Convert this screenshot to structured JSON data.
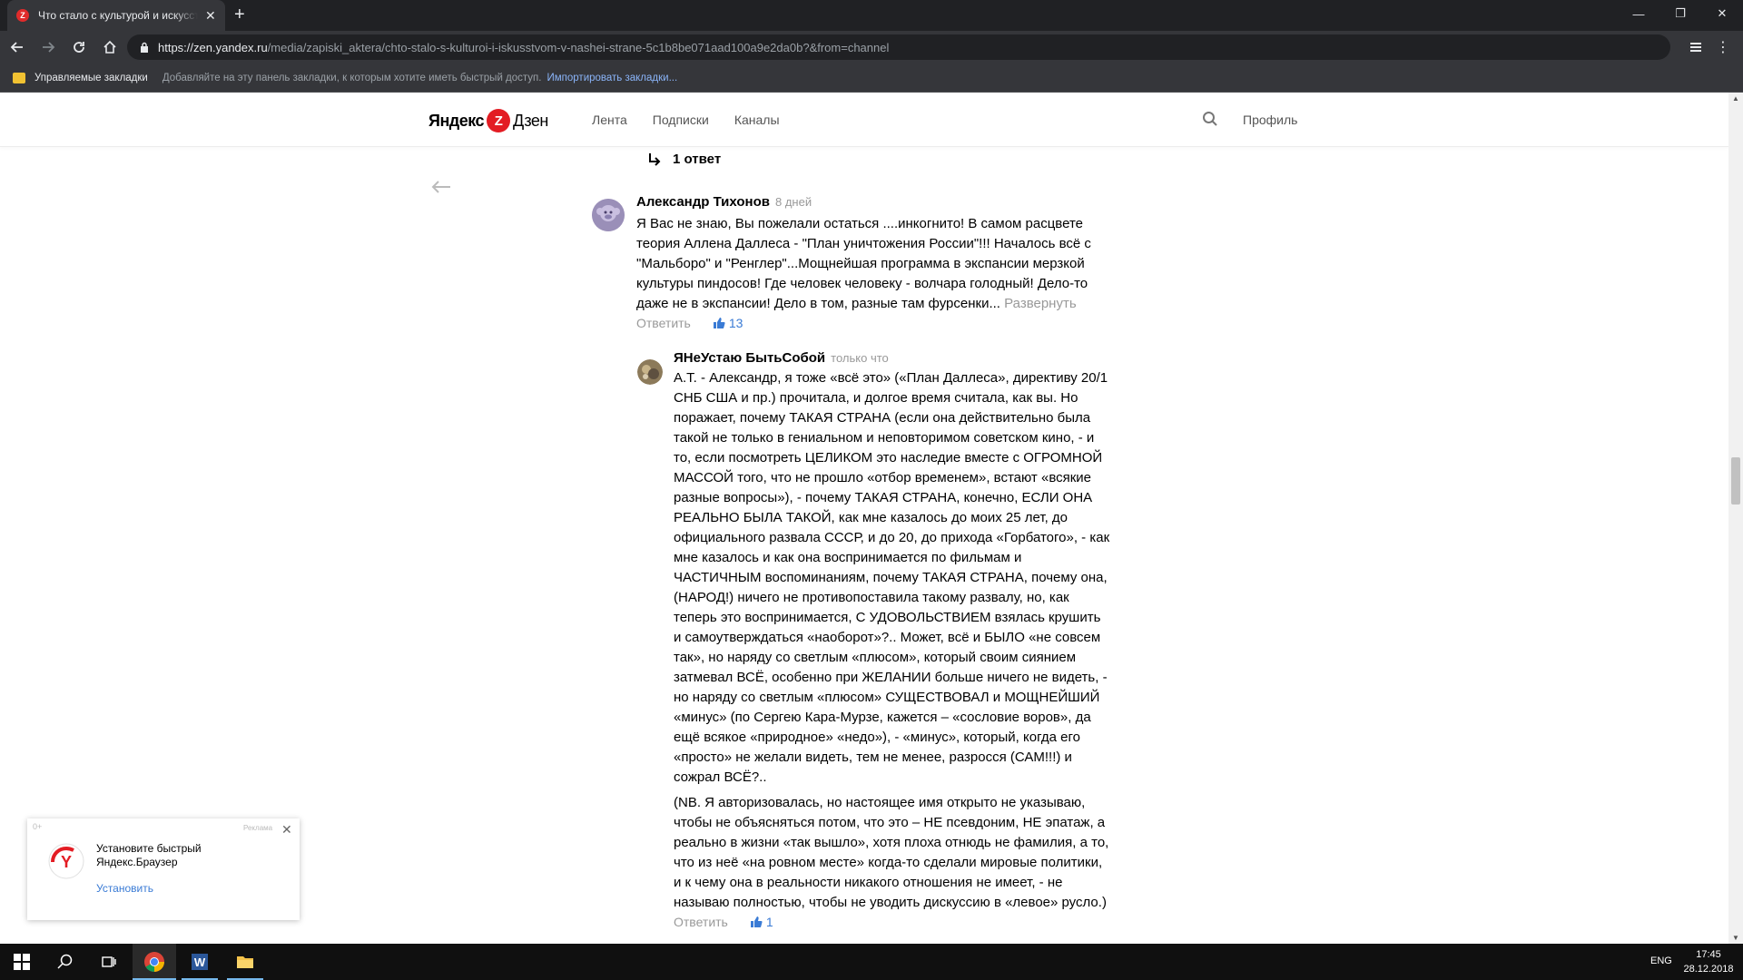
{
  "browser": {
    "tab_title": "Что стало с культурой и искусством в нашей стране",
    "tab_favicon_letter": "Z",
    "url_host": "https://zen.yandex.ru",
    "url_path": "/media/zapiski_aktera/chto-stalo-s-kulturoi-i-iskusstvom-v-nashei-strane-5c1b8be071aad100a9e2da0b?&from=channel",
    "bookmarks": {
      "managed": "Управляемые закладки",
      "hint": "Добавляйте на эту панель закладки, к которым хотите иметь быстрый доступ.",
      "import": "Импортировать закладки..."
    }
  },
  "zen": {
    "logo_ya": "Яндекс",
    "logo_z": "Z",
    "logo_dzen": "Дзен",
    "nav": [
      "Лента",
      "Подписки",
      "Каналы"
    ],
    "profile": "Профиль",
    "accent": "#e31c23"
  },
  "thread": {
    "replies_label": "1 ответ"
  },
  "comments": [
    {
      "author": "Александр Тихонов",
      "time": "8 дней",
      "lines": [
        "Я Вас не знаю, Вы пожелали остаться ....инкогнито! В самом расцвете",
        "теория Аллена Даллеса - \"План уничтожения России\"!!! Началось всё с",
        "\"Мальборо\" и \"Ренглер\"...Мощнейшая программа в экспансии мерзкой",
        "культуры пиндосов! Где человек человеку - волчара голодный! Дело-то",
        "даже не в экспансии! Дело в том, разные там фурсенки..."
      ],
      "expand": "Развернуть",
      "reply": "Ответить",
      "likes": "13"
    },
    {
      "author": "ЯНеУстаю БытьСобой",
      "time": "только что",
      "lines": [
        "А.Т. - Александр, я тоже «всё это» («План Даллеса», директиву 20/1",
        "СНБ США и пр.) прочитала, и долгое время считала, как вы. Но",
        "поражает, почему ТАКАЯ СТРАНА (если она действительно была",
        "такой не только в гениальном и неповторимом советском кино, - и",
        "то, если посмотреть ЦЕЛИКОМ это наследие вместе с ОГРОМНОЙ",
        "МАССОЙ того, что не прошло «отбор временем», встают «всякие",
        "разные вопросы»), - почему ТАКАЯ СТРАНА, конечно, ЕСЛИ ОНА",
        "РЕАЛЬНО БЫЛА ТАКОЙ, как мне казалось до моих 25 лет, до",
        "официального развала СССР, и до 20, до прихода «Горбатого», - как",
        "мне казалось и как она воспринимается по фильмам и",
        "ЧАСТИЧНЫМ воспоминаниям, почему ТАКАЯ СТРАНА, почему она,",
        "(НАРОД!) ничего не противопоставила такому развалу, но, как",
        "теперь это воспринимается, С УДОВОЛЬСТВИЕМ взялась крушить",
        "и самоутверждаться «наоборот»?.. Может, всё и БЫЛО «не совсем",
        "так», но наряду со светлым «плюсом», который своим сиянием",
        "затмевал ВСЁ, особенно при ЖЕЛАНИИ больше ничего не видеть, -",
        "но наряду со светлым «плюсом» СУЩЕСТВОВАЛ и МОЩНЕЙШИЙ",
        "«минус» (по Сергею Кара-Мурзе, кажется – «сословие воров», да",
        "ещё всякое «природное» «недо»), - «минус», который, когда его",
        "«просто» не желали видеть, тем не менее, разросся (САМ!!!) и",
        "сожрал ВСЁ?.."
      ],
      "lines2": [
        "(NB. Я авторизовалась, но настоящее имя открыто не указываю,",
        "чтобы не объясняться потом, что это – НЕ псевдоним, НЕ эпатаж, а",
        "реально в жизни «так вышло», хотя плоха отнюдь не фамилия, а то,",
        "что из неё «на ровном месте» когда-то сделали мировые политики,",
        "и к чему она в реальности никакого отношения не имеет, - не",
        "называю полностью, чтобы не уводить дискуссию в «левое» русло.)"
      ],
      "reply": "Ответить",
      "likes": "1"
    }
  ],
  "ad": {
    "age": "0+",
    "label": "Реклама",
    "text": "Установите быстрый Яндекс.Браузер",
    "install": "Установить"
  },
  "taskbar": {
    "lang": "ENG",
    "time": "17:45",
    "date": "28.12.2018"
  }
}
